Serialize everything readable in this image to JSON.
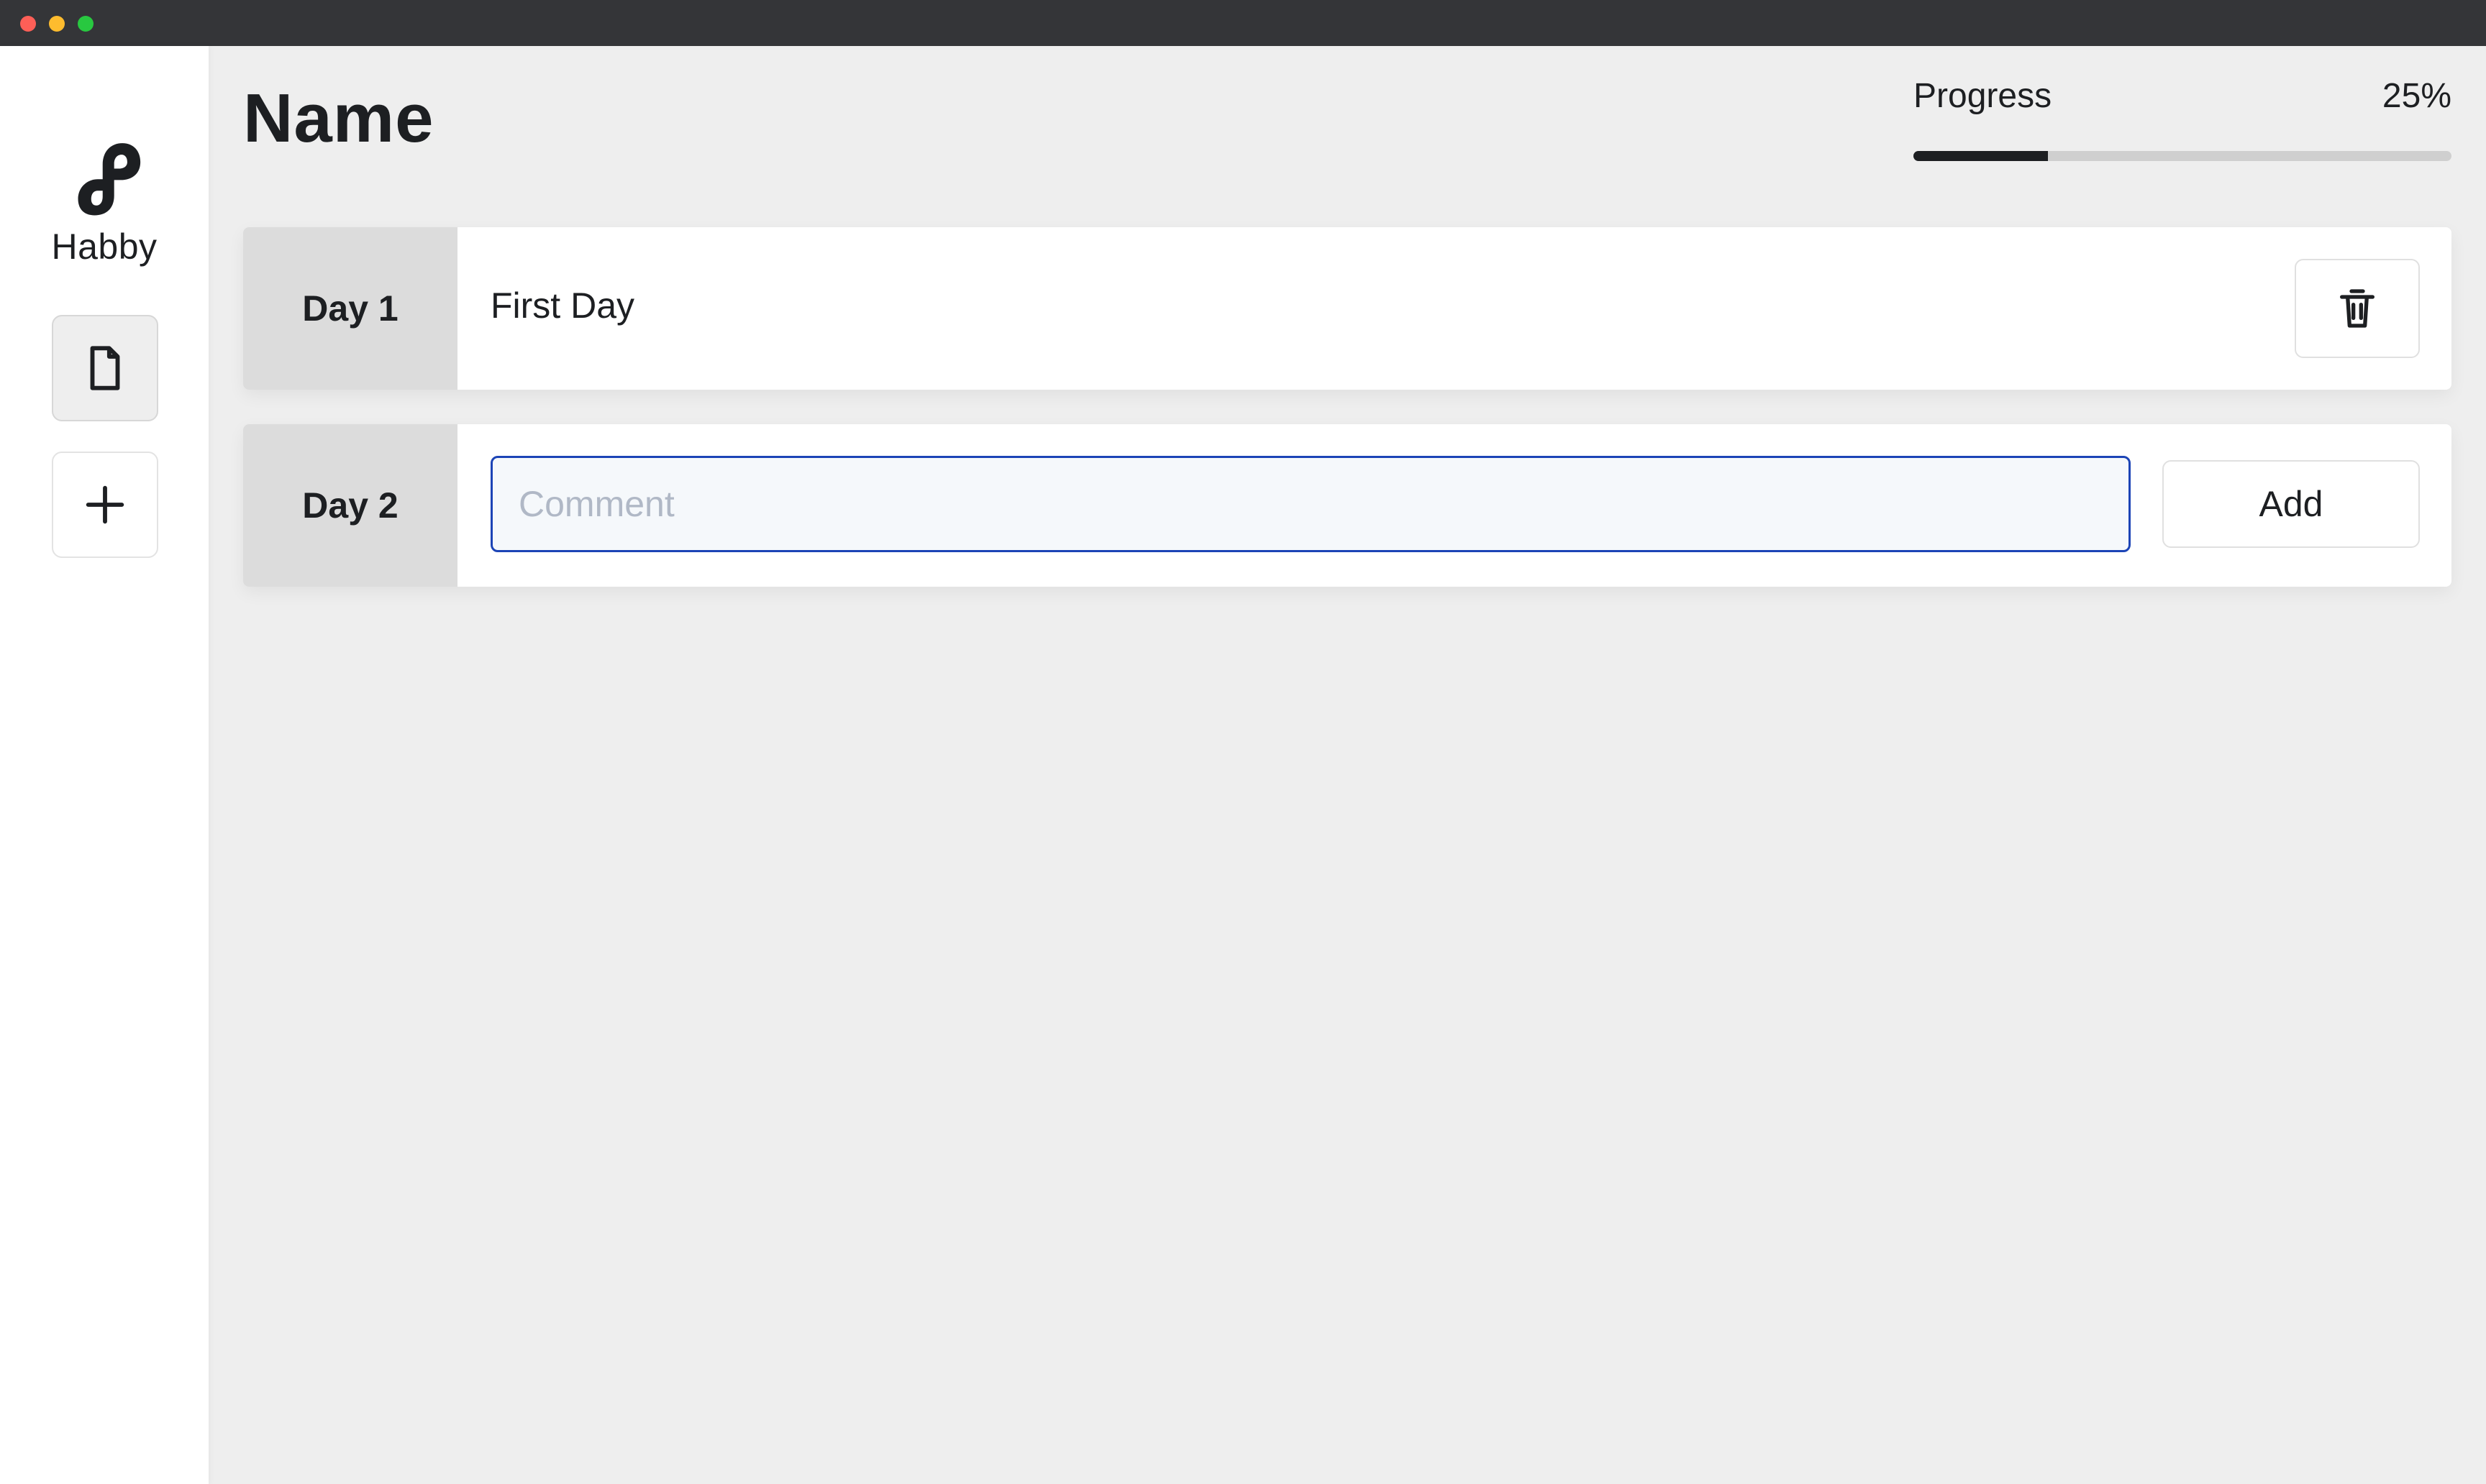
{
  "window": {
    "controls": [
      "close",
      "minimize",
      "zoom"
    ]
  },
  "sidebar": {
    "brand": "Habby",
    "logo_icon": "habby-logo-icon",
    "nav": [
      {
        "icon": "document-icon",
        "active": true
      },
      {
        "icon": "plus-icon",
        "active": false
      }
    ]
  },
  "header": {
    "title": "Name",
    "progress_label": "Progress",
    "progress_value": "25%",
    "progress_fraction": 0.25
  },
  "days": [
    {
      "label": "Day 1",
      "text": "First Day",
      "action_icon": "trash-icon"
    },
    {
      "label": "Day 2",
      "input_placeholder": "Comment",
      "input_value": "",
      "action_label": "Add"
    }
  ],
  "colors": {
    "accent": "#1c44b6",
    "text": "#1d1f22",
    "background": "#eeeeee",
    "sidebar": "#ffffff",
    "day_label_bg": "#dcdcdc",
    "progress_track": "#cfcfcf",
    "progress_fill": "#1d1f22"
  }
}
